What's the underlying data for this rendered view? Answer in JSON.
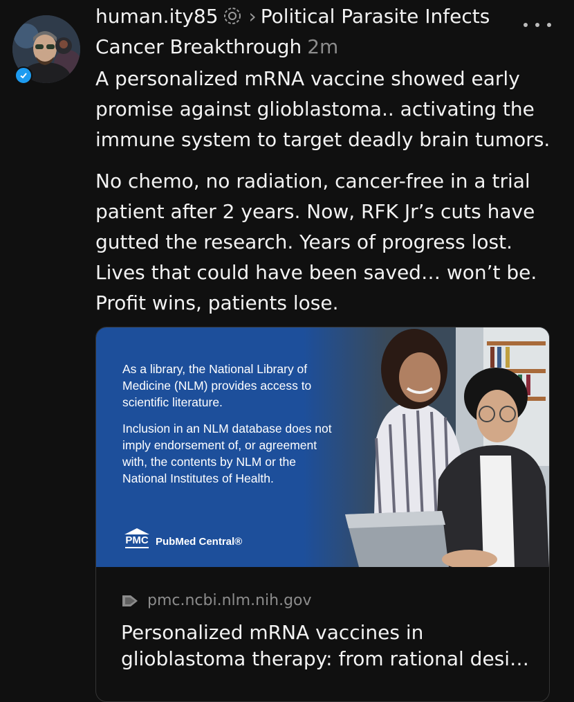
{
  "post": {
    "username": "human.ity85",
    "topic_line1": "Political Parasite Infects",
    "topic_line2": "Cancer Breakthrough",
    "timestamp": "2m",
    "paragraph1": "A personalized mRNA vaccine showed early promise against glioblastoma.. activating the immune system to target deadly brain tumors.",
    "paragraph2": "No chemo, no radiation, cancer-free in a trial patient after 2 years. Now, RFK Jr’s cuts have gutted the research. Years of progress lost. Lives that could have been saved… won’t be. Profit wins, patients lose."
  },
  "card": {
    "notice1": "As a library, the National Library of Medicine (NLM) provides access to scientific literature.",
    "notice2": "Inclusion in an NLM database does not imply endorsement of, or agreement with, the contents by NLM or the National Institutes of Health.",
    "logo_mark": "PMC",
    "logo_name": "PubMed Central®",
    "domain": "pmc.ncbi.nlm.nih.gov",
    "title": "Personalized mRNA vaccines in glioblastoma therapy: from rational desi…"
  },
  "colors": {
    "background": "#101010",
    "text": "#f3f3f3",
    "muted": "#8c8c8c",
    "card_blue": "#1d4f9b",
    "verified": "#1d9bf0"
  },
  "icons": {
    "more": "more-dots-icon",
    "topic": "topic-icon",
    "verified": "verified-badge-icon",
    "link": "link-arrow-icon"
  }
}
